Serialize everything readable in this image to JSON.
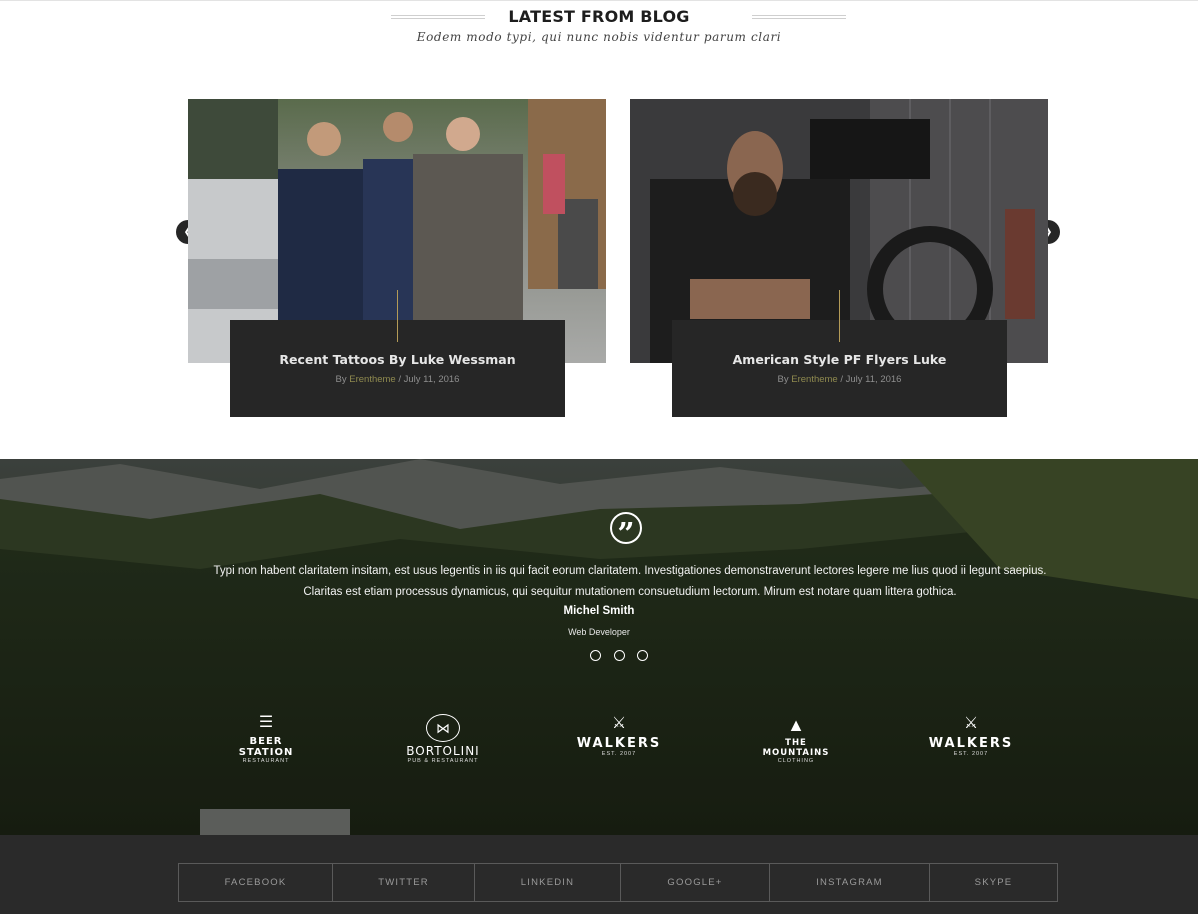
{
  "blog": {
    "title": "LATEST FROM BLOG",
    "subtitle": "Eodem modo typi, qui nunc nobis videntur parum clari",
    "prev_icon": "chevron-left-icon",
    "next_icon": "chevron-right-icon",
    "posts": [
      {
        "title": "Recent Tattoos By Luke Wessman",
        "by": "By",
        "author": "Erentheme",
        "date": " / July 11, 2016"
      },
      {
        "title": "American Style PF Flyers Luke",
        "by": "By",
        "author": "Erentheme",
        "date": " / July 11, 2016"
      }
    ]
  },
  "testimonial": {
    "icon": "quote-icon",
    "text": "Typi non habent claritatem insitam, est usus legentis in iis qui facit eorum claritatem. Investigationes demonstraverunt lectores legere me lius quod ii legunt saepius. Claritas est etiam processus dynamicus, qui sequitur mutationem consuetudium lectorum. Mirum est notare quam littera gothica.",
    "name": "Michel Smith",
    "role": "Web Developer",
    "slides": 3
  },
  "brands": [
    {
      "name": "BEER STATION",
      "sub": "RESTAURANT",
      "icon": "beer-glass-icon"
    },
    {
      "name": "BORTOLINI",
      "sub": "PUB & RESTAURANT",
      "icon": "bowtie-icon"
    },
    {
      "name": "WALKERS",
      "sub": "EST. 2007",
      "icon": "crossed-axes-icon"
    },
    {
      "name": "THE MOUNTAINS",
      "sub": "CLOTHING",
      "icon": "mountain-icon"
    },
    {
      "name": "WALKERS",
      "sub": "EST. 2007",
      "icon": "crossed-axes-icon"
    }
  ],
  "social": [
    "FACEBOOK",
    "TWITTER",
    "LINKEDIN",
    "GOOGLE+",
    "INSTAGRAM",
    "SKYPE"
  ],
  "colors": {
    "dark": "#262626",
    "accent": "#b49b57",
    "footer": "#2a2a2a"
  }
}
